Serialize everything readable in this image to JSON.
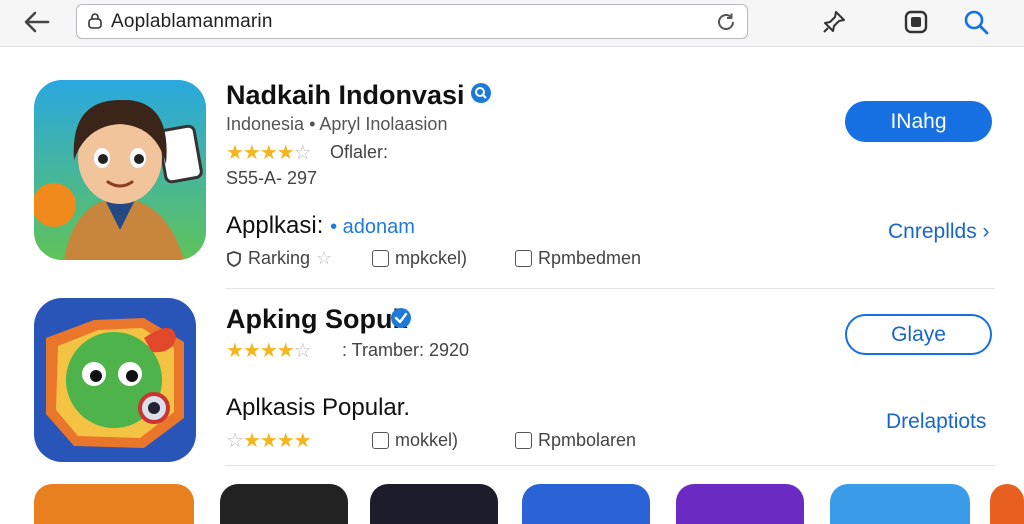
{
  "browser": {
    "url": "Aoplablamanmarin"
  },
  "app1": {
    "title": "Nadkaih Indonvasi",
    "subtitle": "Indonesia • Apryl Inolaasion",
    "rating_text": "Oflaler:",
    "stars": 4.5,
    "meta": "S55-A- 297",
    "section_label": "Applkasi:",
    "section_tag": "• adonam",
    "feature_1": "Rarking",
    "feature_2": "mpkckel)",
    "feature_3": "Rpmbedmen",
    "install_button": "INahg",
    "more_link": "Cnrepllds ›"
  },
  "app2": {
    "title": "Apking Sopuk",
    "stars": 4.5,
    "rating_text": ": Tramber: 2920",
    "section_label": "Aplkasis Popular.",
    "feature_1": "mokkel)",
    "feature_2": "Rpmbolaren",
    "stars_row2": 4,
    "open_button": "Glaye",
    "more_link": "Drelaptiots"
  },
  "colors": {
    "accent": "#1670e2",
    "star": "#f3b61f"
  }
}
